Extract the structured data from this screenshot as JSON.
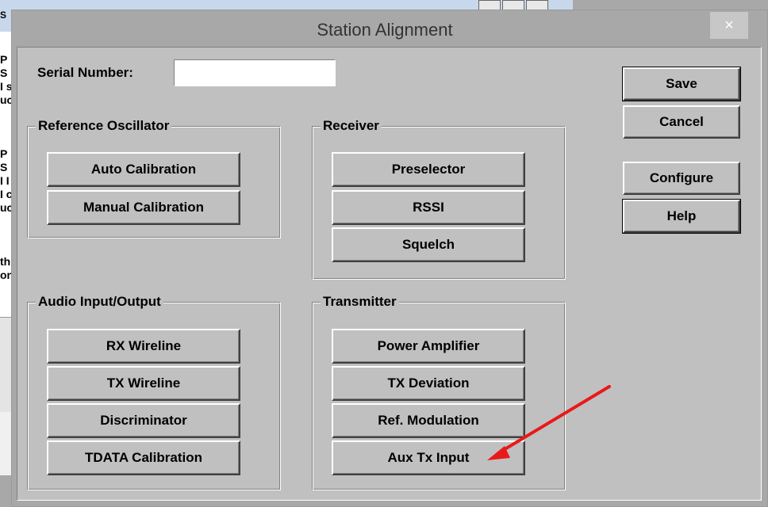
{
  "background_window": {
    "title_fragment": "S",
    "text_lines": [
      "P",
      "S",
      "I s",
      "uc",
      "",
      "P",
      "S",
      "I I",
      "I c",
      "uc",
      "",
      "th",
      "on"
    ]
  },
  "dialog": {
    "title": "Station Alignment",
    "close_label": "×",
    "serial": {
      "label": "Serial Number:",
      "value": ""
    },
    "actions": {
      "save": "Save",
      "cancel": "Cancel",
      "configure": "Configure",
      "help": "Help"
    },
    "groups": {
      "reference_oscillator": {
        "title": "Reference Oscillator",
        "buttons": [
          "Auto Calibration",
          "Manual Calibration"
        ]
      },
      "receiver": {
        "title": "Receiver",
        "buttons": [
          "Preselector",
          "RSSI",
          "Squelch"
        ]
      },
      "audio": {
        "title": "Audio Input/Output",
        "buttons": [
          "RX Wireline",
          "TX Wireline",
          "Discriminator",
          "TDATA Calibration"
        ]
      },
      "transmitter": {
        "title": "Transmitter",
        "buttons": [
          "Power Amplifier",
          "TX Deviation",
          "Ref. Modulation",
          "Aux Tx Input"
        ]
      }
    }
  },
  "annotation": {
    "arrow_color": "#e8191a"
  }
}
